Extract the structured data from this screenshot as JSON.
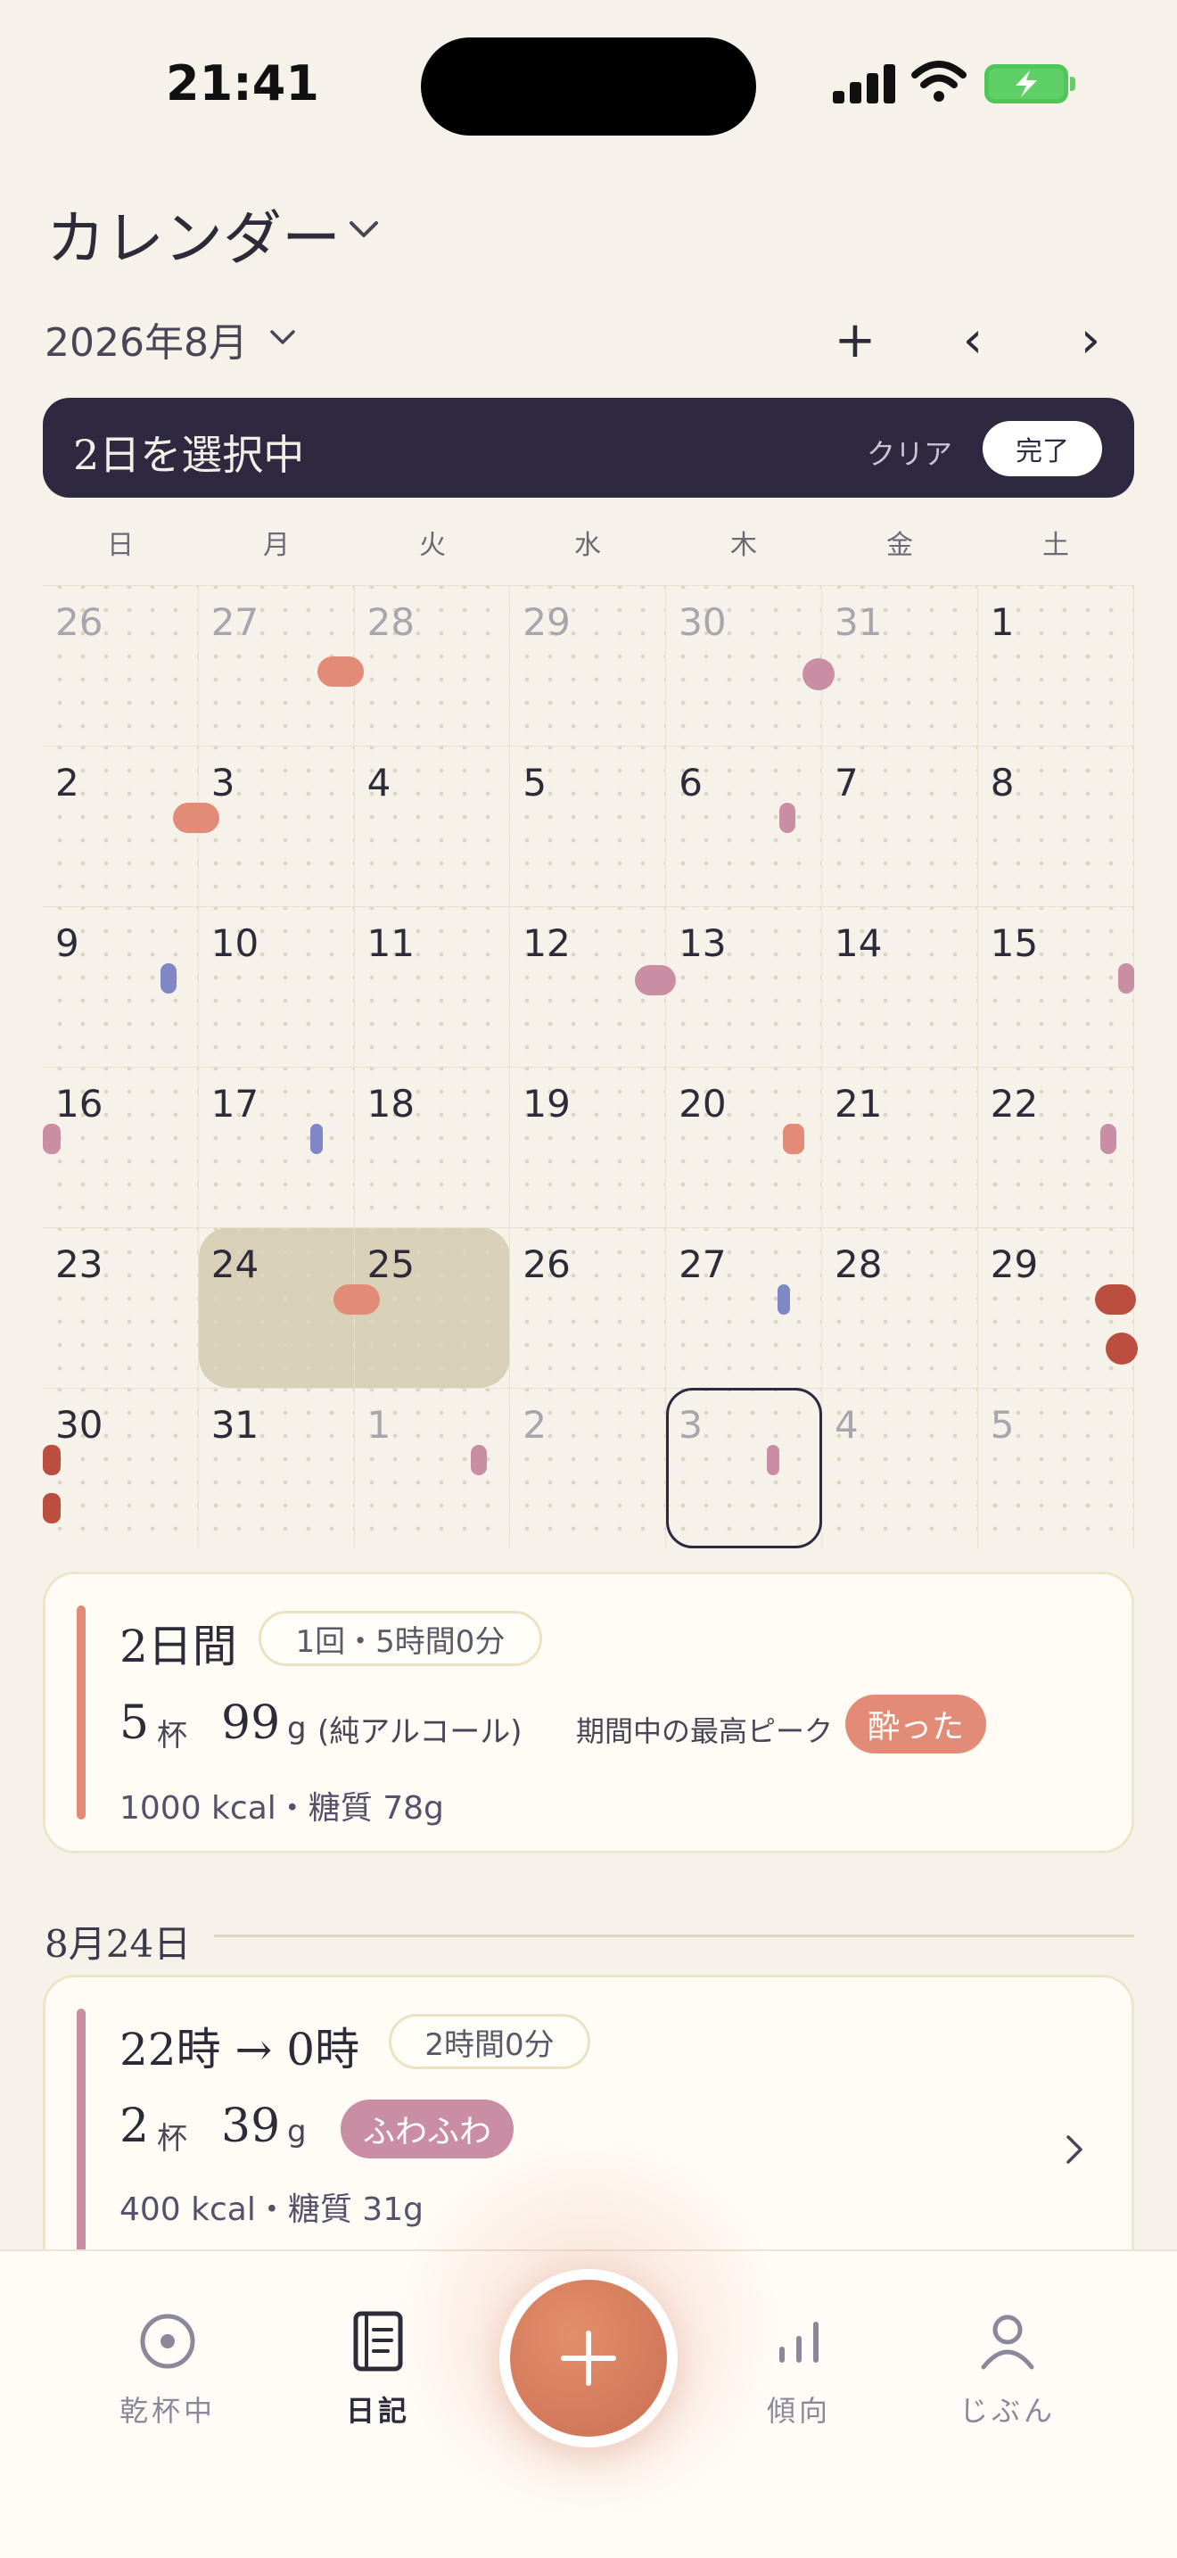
{
  "status": {
    "time": "21:41"
  },
  "header": {
    "title": "カレンダー",
    "month": "2026年8月"
  },
  "nav": {
    "add": "+",
    "prev": "‹",
    "next": "›"
  },
  "selection": {
    "label": "2日を選択中",
    "clear": "クリア",
    "done": "完了"
  },
  "weekdays": [
    "日",
    "月",
    "火",
    "水",
    "木",
    "金",
    "土"
  ],
  "calendar": {
    "weeks": [
      [
        "26",
        "27",
        "28",
        "29",
        "30",
        "31",
        "1"
      ],
      [
        "2",
        "3",
        "4",
        "5",
        "6",
        "7",
        "8"
      ],
      [
        "9",
        "10",
        "11",
        "12",
        "13",
        "14",
        "15"
      ],
      [
        "16",
        "17",
        "18",
        "19",
        "20",
        "21",
        "22"
      ],
      [
        "23",
        "24",
        "25",
        "26",
        "27",
        "28",
        "29"
      ],
      [
        "30",
        "31",
        "1",
        "2",
        "3",
        "4",
        "5"
      ]
    ],
    "selected_range": [
      "24",
      "25"
    ],
    "today": "3"
  },
  "colors": {
    "salmon": "#e28b76",
    "mauve": "#c98ea3",
    "blue": "#7f88c4",
    "red": "#bc4e3f",
    "navy": "#2e2841",
    "selected": "#d9d0b8"
  },
  "summary": {
    "title": "2日間",
    "chip": "1回・5時間0分",
    "cups": "5",
    "cups_unit": "杯",
    "grams": "99",
    "grams_unit": "g",
    "pure": "(純アルコール)",
    "peak_label": "期間中の最高ピーク",
    "peak_badge": "酔った",
    "sub": "1000 kcal・糖質 78g"
  },
  "day_section": {
    "date": "8月24日"
  },
  "entry": {
    "title": "22時 → 0時",
    "chip": "2時間0分",
    "cups": "2",
    "cups_unit": "杯",
    "grams": "39",
    "grams_unit": "g",
    "badge": "ふわふわ",
    "sub": "400 kcal・糖質 31g"
  },
  "tabs": {
    "active_tab": "日記",
    "items": [
      {
        "label": "乾杯中",
        "icon": "record-circle-icon"
      },
      {
        "label": "日記",
        "icon": "notebook-icon"
      },
      {
        "label": "傾向",
        "icon": "bar-chart-icon"
      },
      {
        "label": "じぶん",
        "icon": "person-icon"
      }
    ],
    "add_icon": "plus-icon"
  }
}
